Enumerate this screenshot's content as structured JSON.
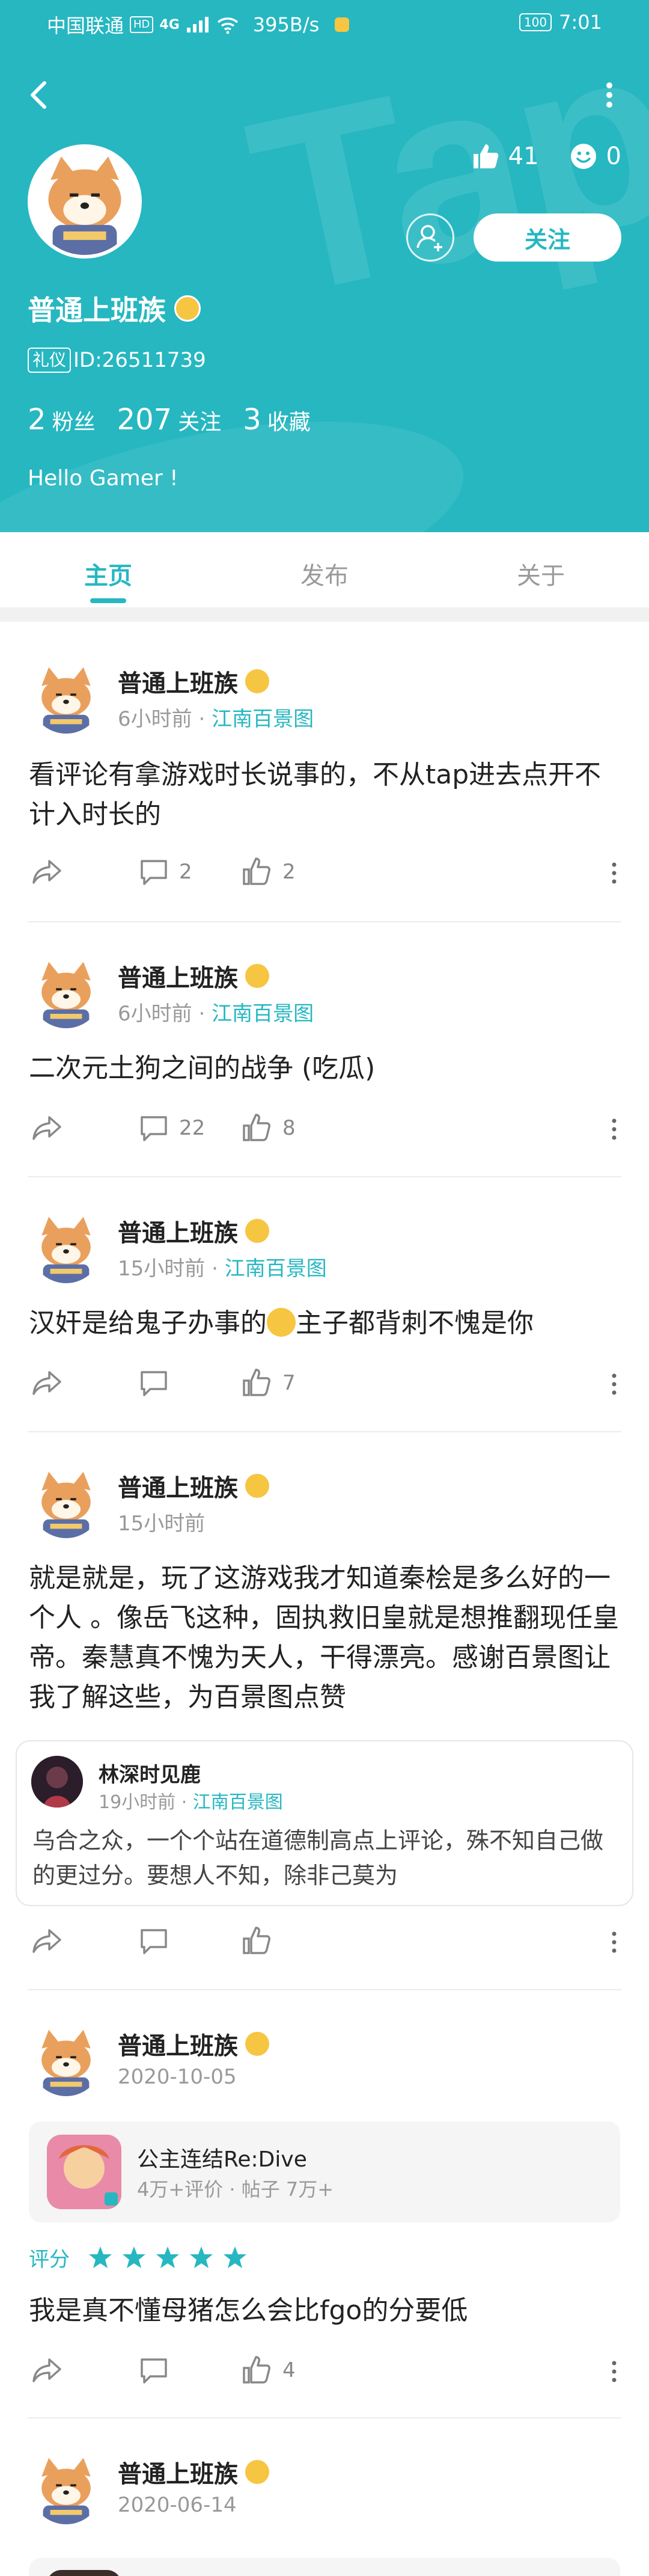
{
  "status_bar": {
    "carrier": "中国联通",
    "hd": "HD",
    "network": "4G",
    "speed": "395B/s",
    "battery": "100",
    "time": "7:01"
  },
  "profile": {
    "likes": "41",
    "emoji_count": "0",
    "follow_label": "关注",
    "username": "普通上班族",
    "id_badge": "礼仪",
    "id_text": "ID:26511739",
    "fans_num": "2",
    "fans_label": "粉丝",
    "following_num": "207",
    "following_label": "关注",
    "fav_num": "3",
    "fav_label": "收藏",
    "bio": "Hello Gamer !"
  },
  "tabs": [
    {
      "label": "主页",
      "active": true
    },
    {
      "label": "发布",
      "active": false
    },
    {
      "label": "关于",
      "active": false
    }
  ],
  "posts": [
    {
      "name": "普通上班族",
      "time": "6小时前",
      "location": "江南百景图",
      "text": "看评论有拿游戏时长说事的，不从tap进去点开不计入时长的",
      "comments": "2",
      "likes": "2"
    },
    {
      "name": "普通上班族",
      "time": "6小时前",
      "location": "江南百景图",
      "text": "二次元土狗之间的战争 (吃瓜)",
      "comments": "22",
      "likes": "8"
    },
    {
      "name": "普通上班族",
      "time": "15小时前",
      "location": "江南百景图",
      "text_a": "汉奸是给鬼子办事的",
      "text_b": "主子都背刺不愧是你",
      "comments": "",
      "likes": "7"
    },
    {
      "name": "普通上班族",
      "time": "15小时前",
      "text": "就是就是，玩了这游戏我才知道秦桧是多么好的一个人 。像岳飞这种，固执救旧皇就是想推翻现任皇帝。秦慧真不愧为天人，干得漂亮。感谢百景图让我了解这些，为百景图点赞",
      "quote": {
        "name": "林深时见鹿",
        "time": "19小时前",
        "location": "江南百景图",
        "text": "乌合之众，一个个站在道德制高点上评论，殊不知自己做的更过分。要想人不知，除非己莫为"
      },
      "comments": "",
      "likes": ""
    },
    {
      "name": "普通上班族",
      "time": "2020-10-05",
      "game": {
        "name": "公主连结Re:Dive",
        "meta": "4万+评价 · 帖子 7万+"
      },
      "rating_label": "评分",
      "rating": 5,
      "text": "我是真不懂母猪怎么会比fgo的分要低",
      "comments": "",
      "likes": "4"
    },
    {
      "name": "普通上班族",
      "time": "2020-06-14"
    }
  ],
  "colors": {
    "accent": "#26b7c1",
    "meta_gray": "#999999",
    "divider": "#ececec"
  }
}
